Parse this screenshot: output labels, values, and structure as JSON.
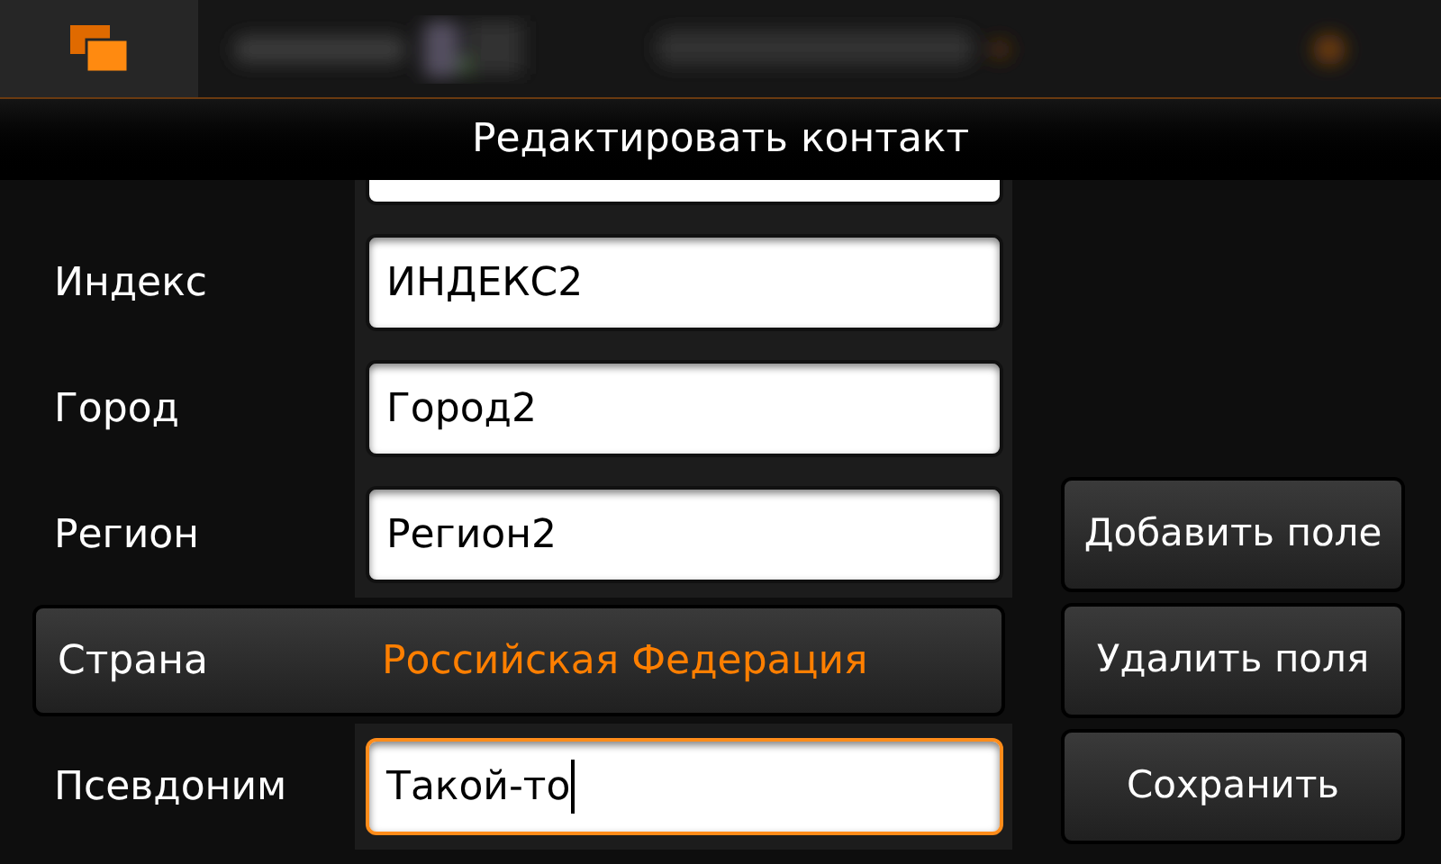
{
  "window": {
    "title": "Редактировать контакт"
  },
  "fields": [
    {
      "kind": "text",
      "label": "Индекс",
      "value": "ИНДЕКС2",
      "focused": false
    },
    {
      "kind": "text",
      "label": "Город",
      "value": "Город2",
      "focused": false
    },
    {
      "kind": "text",
      "label": "Регион",
      "value": "Регион2",
      "focused": false
    },
    {
      "kind": "picker",
      "label": "Страна",
      "value": "Российская Федерация"
    },
    {
      "kind": "text",
      "label": "Псевдоним",
      "value": "Такой-то",
      "focused": true
    }
  ],
  "buttons": [
    "Добавить поле",
    "Удалить поля",
    "Сохранить"
  ]
}
